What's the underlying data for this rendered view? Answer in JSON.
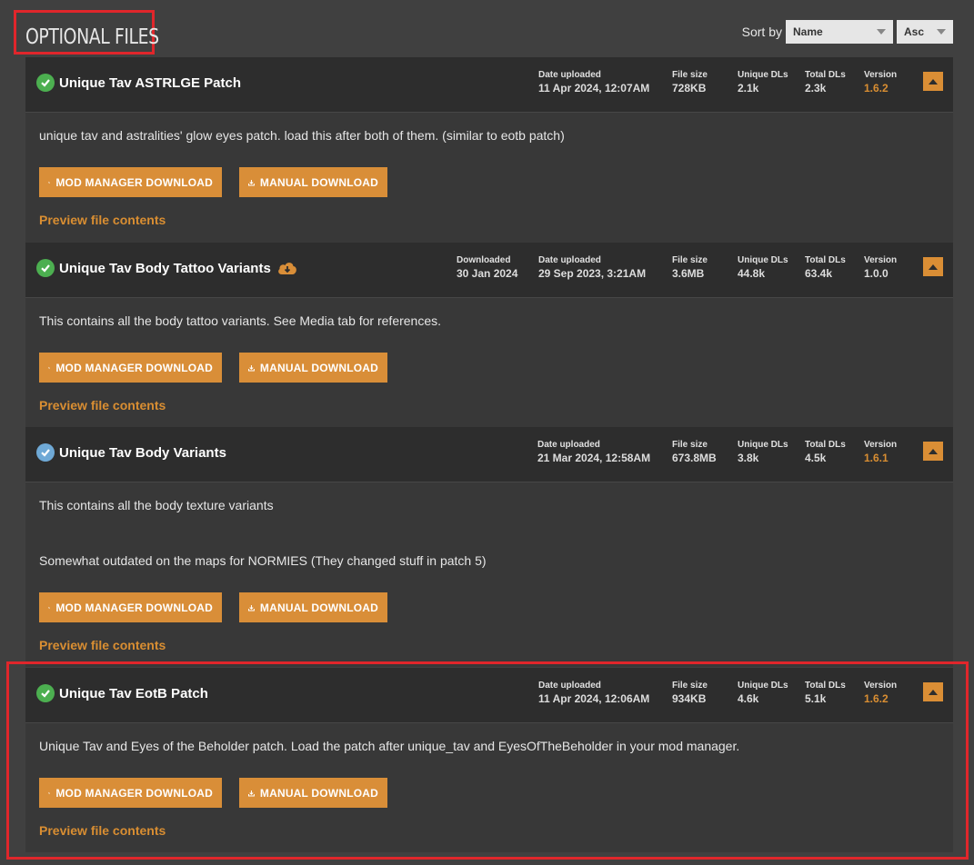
{
  "section": {
    "title": "OPTIONAL FILES"
  },
  "sort": {
    "label": "Sort by",
    "field": "Name",
    "direction": "Asc"
  },
  "labels": {
    "downloaded": "Downloaded",
    "date_uploaded": "Date uploaded",
    "file_size": "File size",
    "unique_dls": "Unique DLs",
    "total_dls": "Total DLs",
    "version": "Version",
    "mod_manager_download": "MOD MANAGER DOWNLOAD",
    "manual_download": "MANUAL DOWNLOAD",
    "preview": "Preview file contents"
  },
  "files": [
    {
      "name": "Unique Tav ASTRLGE Patch",
      "status": "green-check",
      "date_uploaded": "11 Apr 2024, 12:07AM",
      "file_size": "728KB",
      "unique_dls": "2.1k",
      "total_dls": "2.3k",
      "version": "1.6.2",
      "description": [
        "unique tav and astralities' glow eyes patch. load this after both of them. (similar to eotb patch)"
      ]
    },
    {
      "name": "Unique Tav Body Tattoo Variants",
      "status": "green-check",
      "downloaded": "30 Jan 2024",
      "date_uploaded": "29 Sep 2023, 3:21AM",
      "file_size": "3.6MB",
      "unique_dls": "44.8k",
      "total_dls": "63.4k",
      "version": "1.0.0",
      "description": [
        "This contains all the body tattoo variants. See Media tab for references."
      ]
    },
    {
      "name": "Unique Tav Body Variants",
      "status": "blue-check",
      "date_uploaded": "21 Mar 2024, 12:58AM",
      "file_size": "673.8MB",
      "unique_dls": "3.8k",
      "total_dls": "4.5k",
      "version": "1.6.1",
      "description": [
        "This contains all the body texture variants",
        "Somewhat outdated on the maps for NORMIES (They changed stuff in patch 5)"
      ]
    },
    {
      "name": "Unique Tav EotB Patch",
      "status": "green-check",
      "date_uploaded": "11 Apr 2024, 12:06AM",
      "file_size": "934KB",
      "unique_dls": "4.6k",
      "total_dls": "5.1k",
      "version": "1.6.2",
      "description": [
        "Unique Tav and Eyes of the Beholder patch. Load the patch after unique_tav and EyesOfTheBeholder in your mod manager."
      ]
    }
  ],
  "colors": {
    "accent": "#d98e38",
    "highlight": "#e0262b",
    "header_bg": "#2d2d2d",
    "body_bg": "#383838"
  }
}
